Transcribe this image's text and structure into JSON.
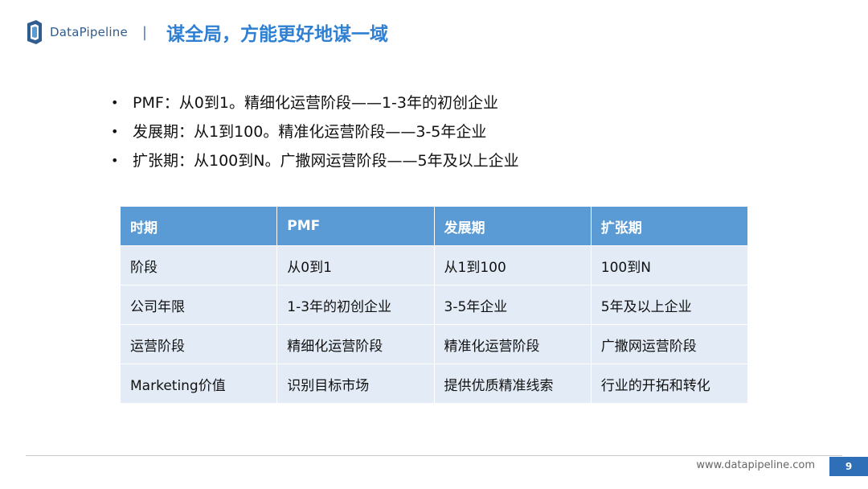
{
  "header": {
    "logo_text": "DataPipeline",
    "divider": "|",
    "title": "谋全局，方能更好地谋一域"
  },
  "bullets": [
    "PMF：从0到1。精细化运营阶段——1-3年的初创企业",
    "发展期：从1到100。精准化运营阶段——3-5年企业",
    "扩张期：从100到N。广撒网运营阶段——5年及以上企业"
  ],
  "table": {
    "headers": [
      "时期",
      "PMF",
      "发展期",
      "扩张期"
    ],
    "rows": [
      [
        "阶段",
        "从0到1",
        "从1到100",
        "100到N"
      ],
      [
        "公司年限",
        "1-3年的初创企业",
        "3-5年企业",
        "5年及以上企业"
      ],
      [
        "运营阶段",
        "精细化运营阶段",
        "精准化运营阶段",
        "广撒网运营阶段"
      ],
      [
        "Marketing价值",
        "识别目标市场",
        "提供优质精准线索",
        "行业的开拓和转化"
      ]
    ]
  },
  "footer": {
    "url": "www.datapipeline.com",
    "page_number": "9"
  },
  "colors": {
    "accent": "#2f7fd2",
    "table_header": "#5a9bd5",
    "table_cell": "#e3ecf6"
  },
  "icons": {
    "logo": "datapipeline-logo-icon"
  }
}
